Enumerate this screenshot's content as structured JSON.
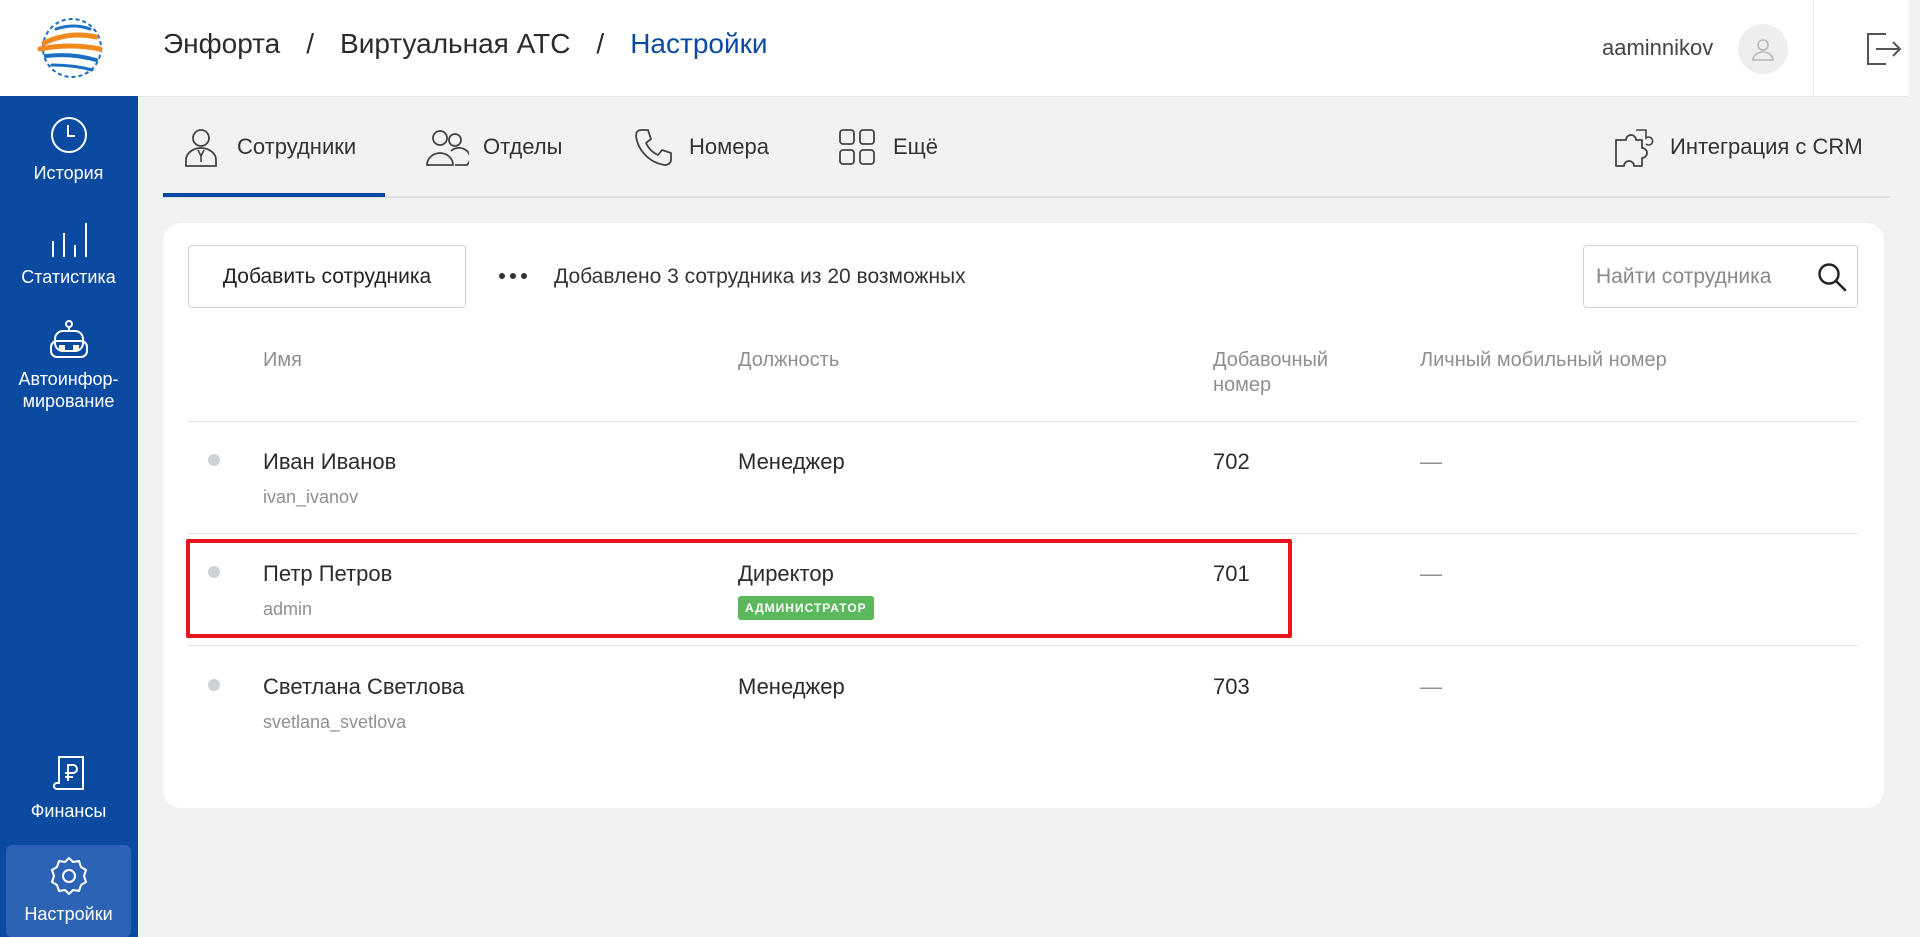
{
  "colors": {
    "sidebar": "#0a4aa1",
    "accent": "#0a4aa1",
    "badge": "#5cb85c",
    "highlight": "#e8141c"
  },
  "sidebar": {
    "items": [
      {
        "label": "История",
        "icon": "clock-icon"
      },
      {
        "label": "Статистика",
        "icon": "bar-chart-icon"
      },
      {
        "label": "Автоинфор-\nмирование",
        "line1": "Автоинфор-",
        "line2": "мирование",
        "icon": "robot-icon"
      },
      {
        "label": "Финансы",
        "icon": "ruble-document-icon"
      },
      {
        "label": "Настройки",
        "icon": "gear-icon",
        "active": true
      }
    ]
  },
  "header": {
    "breadcrumb": [
      "Энфорта",
      "Виртуальная АТС",
      "Настройки"
    ],
    "separator": "/",
    "username": "aaminnikov"
  },
  "tabs": [
    {
      "label": "Сотрудники",
      "icon": "employee-icon",
      "active": true
    },
    {
      "label": "Отделы",
      "icon": "departments-icon"
    },
    {
      "label": "Номера",
      "icon": "phone-icon"
    },
    {
      "label": "Ещё",
      "icon": "grid-icon"
    },
    {
      "label": "Интеграция с CRM",
      "icon": "puzzle-icon"
    }
  ],
  "toolbar": {
    "add_label": "Добавить сотрудника",
    "info": "Добавлено 3 сотрудника из 20 возможных",
    "search_placeholder": "Найти сотрудника"
  },
  "table": {
    "columns": [
      "Имя",
      "Должность",
      "Добавочный номер",
      "Личный мобильный номер"
    ],
    "col_ext_line1": "Добавочный",
    "col_ext_line2": "номер",
    "rows": [
      {
        "name": "Иван Иванов",
        "login": "ivan_ivanov",
        "position": "Менеджер",
        "badge": "",
        "ext": "702",
        "mobile": "—"
      },
      {
        "name": "Петр Петров",
        "login": "admin",
        "position": "Директор",
        "badge": "АДМИНИСТРАТОР",
        "ext": "701",
        "mobile": "—"
      },
      {
        "name": "Светлана Светлова",
        "login": "svetlana_svetlova",
        "position": "Менеджер",
        "badge": "",
        "ext": "703",
        "mobile": "—"
      }
    ]
  }
}
